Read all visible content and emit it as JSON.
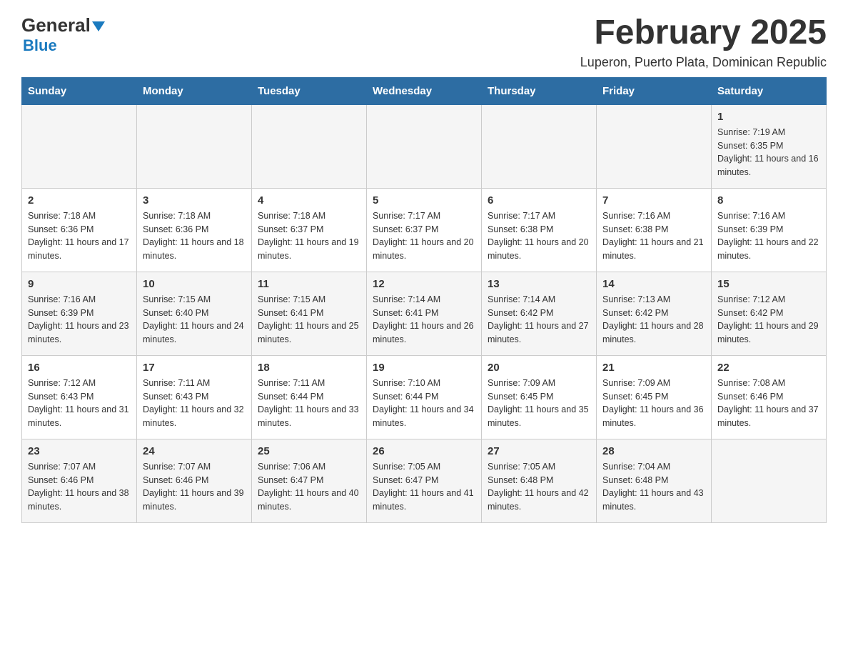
{
  "header": {
    "logo_line1": "General",
    "logo_line2": "Blue",
    "month_title": "February 2025",
    "location": "Luperon, Puerto Plata, Dominican Republic"
  },
  "days_of_week": [
    "Sunday",
    "Monday",
    "Tuesday",
    "Wednesday",
    "Thursday",
    "Friday",
    "Saturday"
  ],
  "weeks": [
    [
      {
        "day": "",
        "info": ""
      },
      {
        "day": "",
        "info": ""
      },
      {
        "day": "",
        "info": ""
      },
      {
        "day": "",
        "info": ""
      },
      {
        "day": "",
        "info": ""
      },
      {
        "day": "",
        "info": ""
      },
      {
        "day": "1",
        "info": "Sunrise: 7:19 AM\nSunset: 6:35 PM\nDaylight: 11 hours and 16 minutes."
      }
    ],
    [
      {
        "day": "2",
        "info": "Sunrise: 7:18 AM\nSunset: 6:36 PM\nDaylight: 11 hours and 17 minutes."
      },
      {
        "day": "3",
        "info": "Sunrise: 7:18 AM\nSunset: 6:36 PM\nDaylight: 11 hours and 18 minutes."
      },
      {
        "day": "4",
        "info": "Sunrise: 7:18 AM\nSunset: 6:37 PM\nDaylight: 11 hours and 19 minutes."
      },
      {
        "day": "5",
        "info": "Sunrise: 7:17 AM\nSunset: 6:37 PM\nDaylight: 11 hours and 20 minutes."
      },
      {
        "day": "6",
        "info": "Sunrise: 7:17 AM\nSunset: 6:38 PM\nDaylight: 11 hours and 20 minutes."
      },
      {
        "day": "7",
        "info": "Sunrise: 7:16 AM\nSunset: 6:38 PM\nDaylight: 11 hours and 21 minutes."
      },
      {
        "day": "8",
        "info": "Sunrise: 7:16 AM\nSunset: 6:39 PM\nDaylight: 11 hours and 22 minutes."
      }
    ],
    [
      {
        "day": "9",
        "info": "Sunrise: 7:16 AM\nSunset: 6:39 PM\nDaylight: 11 hours and 23 minutes."
      },
      {
        "day": "10",
        "info": "Sunrise: 7:15 AM\nSunset: 6:40 PM\nDaylight: 11 hours and 24 minutes."
      },
      {
        "day": "11",
        "info": "Sunrise: 7:15 AM\nSunset: 6:41 PM\nDaylight: 11 hours and 25 minutes."
      },
      {
        "day": "12",
        "info": "Sunrise: 7:14 AM\nSunset: 6:41 PM\nDaylight: 11 hours and 26 minutes."
      },
      {
        "day": "13",
        "info": "Sunrise: 7:14 AM\nSunset: 6:42 PM\nDaylight: 11 hours and 27 minutes."
      },
      {
        "day": "14",
        "info": "Sunrise: 7:13 AM\nSunset: 6:42 PM\nDaylight: 11 hours and 28 minutes."
      },
      {
        "day": "15",
        "info": "Sunrise: 7:12 AM\nSunset: 6:42 PM\nDaylight: 11 hours and 29 minutes."
      }
    ],
    [
      {
        "day": "16",
        "info": "Sunrise: 7:12 AM\nSunset: 6:43 PM\nDaylight: 11 hours and 31 minutes."
      },
      {
        "day": "17",
        "info": "Sunrise: 7:11 AM\nSunset: 6:43 PM\nDaylight: 11 hours and 32 minutes."
      },
      {
        "day": "18",
        "info": "Sunrise: 7:11 AM\nSunset: 6:44 PM\nDaylight: 11 hours and 33 minutes."
      },
      {
        "day": "19",
        "info": "Sunrise: 7:10 AM\nSunset: 6:44 PM\nDaylight: 11 hours and 34 minutes."
      },
      {
        "day": "20",
        "info": "Sunrise: 7:09 AM\nSunset: 6:45 PM\nDaylight: 11 hours and 35 minutes."
      },
      {
        "day": "21",
        "info": "Sunrise: 7:09 AM\nSunset: 6:45 PM\nDaylight: 11 hours and 36 minutes."
      },
      {
        "day": "22",
        "info": "Sunrise: 7:08 AM\nSunset: 6:46 PM\nDaylight: 11 hours and 37 minutes."
      }
    ],
    [
      {
        "day": "23",
        "info": "Sunrise: 7:07 AM\nSunset: 6:46 PM\nDaylight: 11 hours and 38 minutes."
      },
      {
        "day": "24",
        "info": "Sunrise: 7:07 AM\nSunset: 6:46 PM\nDaylight: 11 hours and 39 minutes."
      },
      {
        "day": "25",
        "info": "Sunrise: 7:06 AM\nSunset: 6:47 PM\nDaylight: 11 hours and 40 minutes."
      },
      {
        "day": "26",
        "info": "Sunrise: 7:05 AM\nSunset: 6:47 PM\nDaylight: 11 hours and 41 minutes."
      },
      {
        "day": "27",
        "info": "Sunrise: 7:05 AM\nSunset: 6:48 PM\nDaylight: 11 hours and 42 minutes."
      },
      {
        "day": "28",
        "info": "Sunrise: 7:04 AM\nSunset: 6:48 PM\nDaylight: 11 hours and 43 minutes."
      },
      {
        "day": "",
        "info": ""
      }
    ]
  ]
}
